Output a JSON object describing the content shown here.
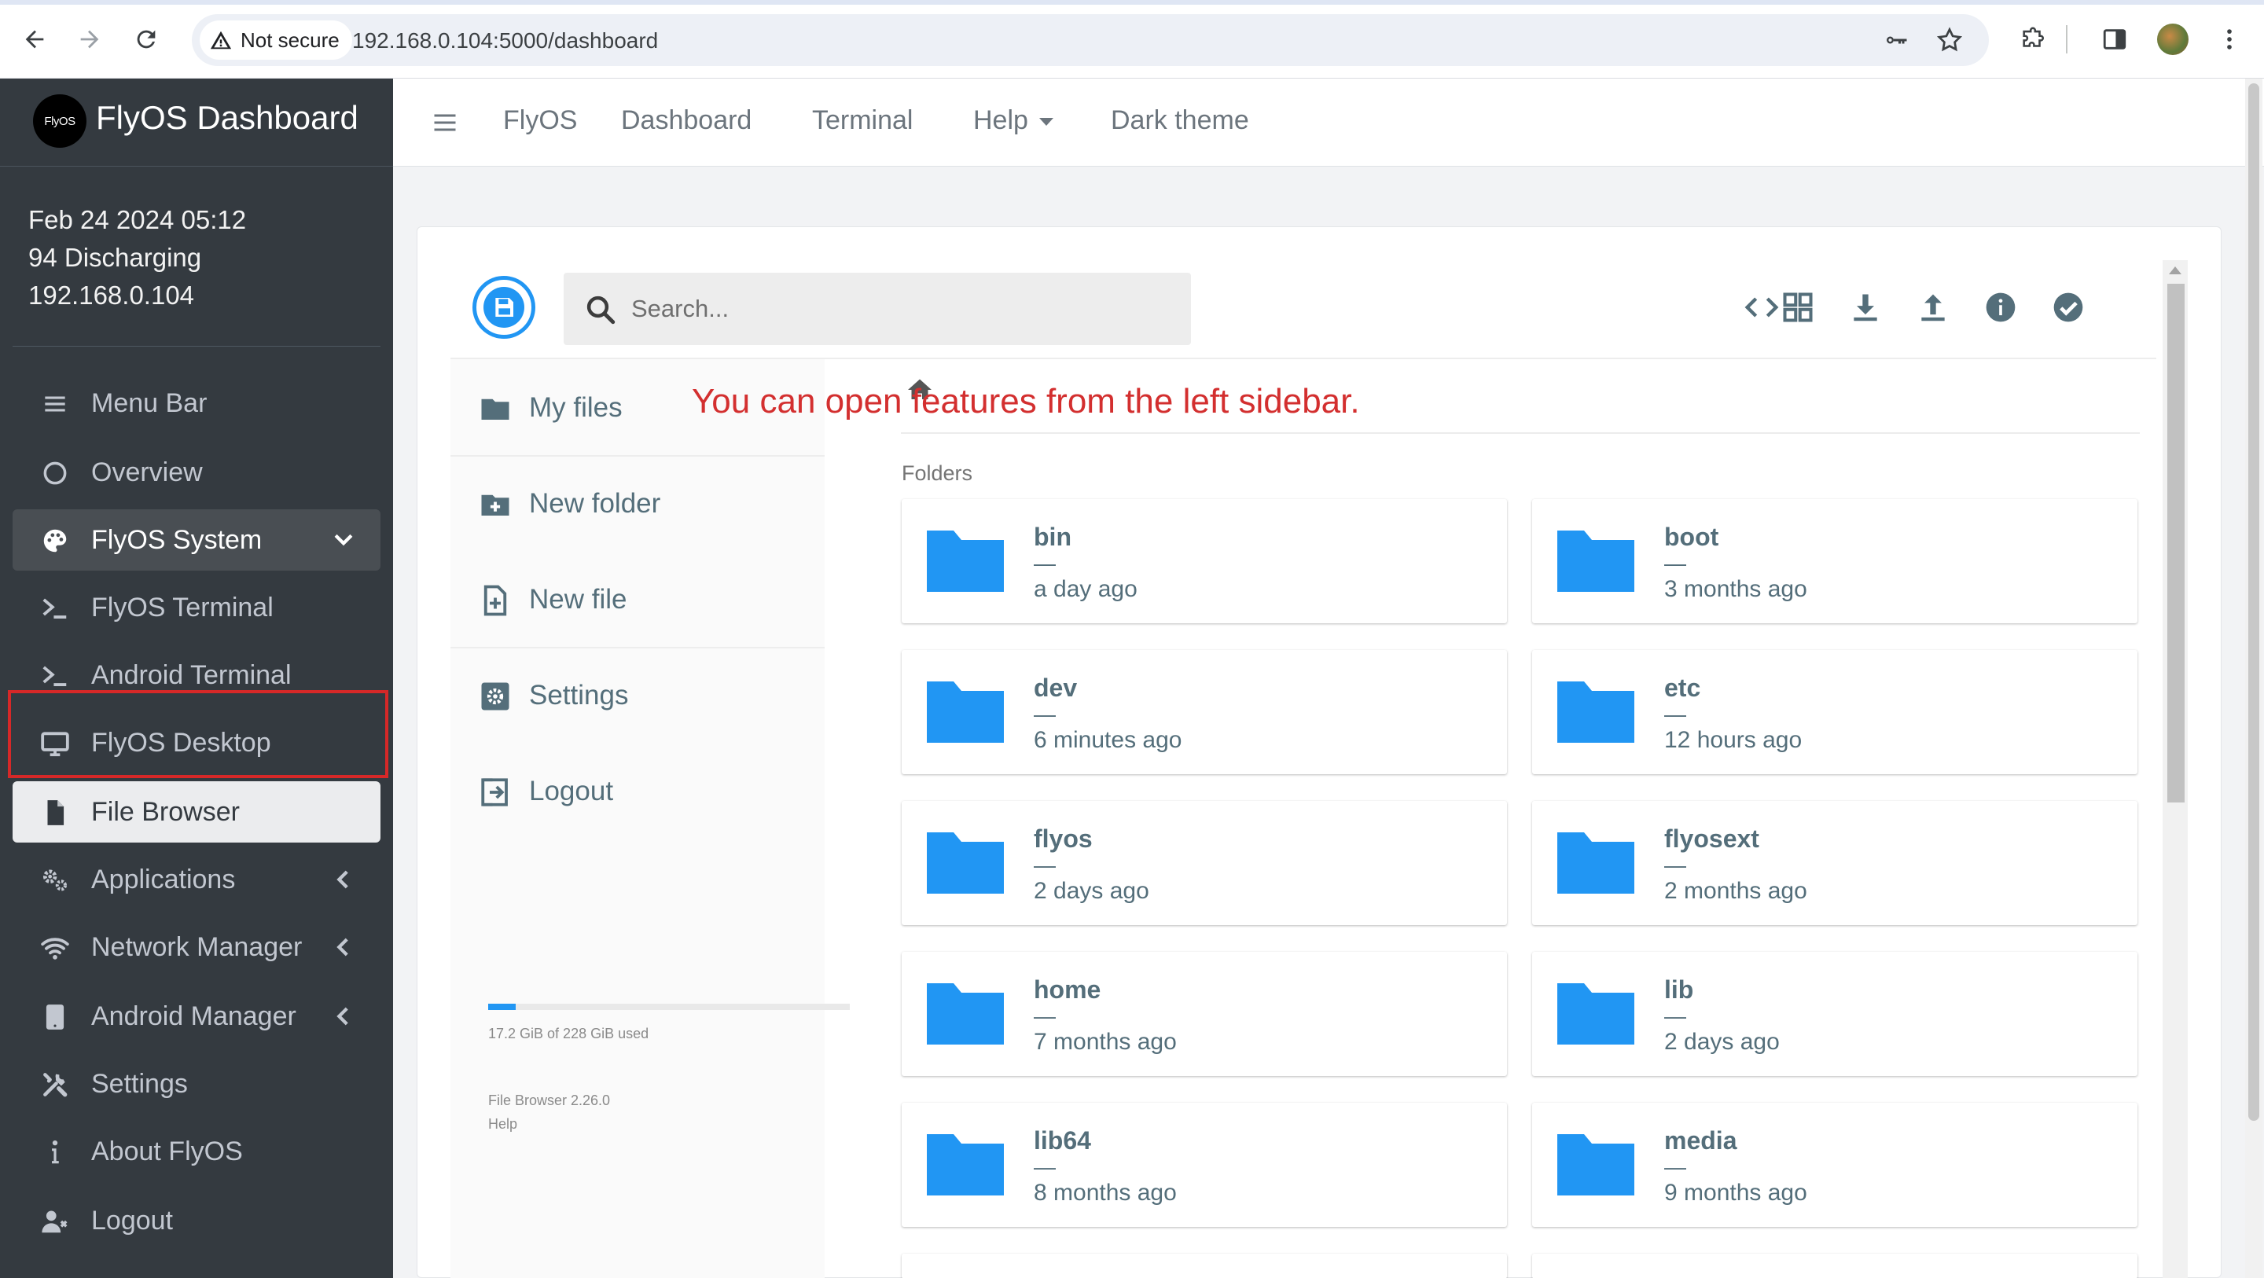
{
  "browser": {
    "security_label": "Not secure",
    "url": "192.168.0.104:5000/dashboard"
  },
  "sidebar": {
    "brand_logo_text": "FlyOS",
    "brand_title": "FlyOS Dashboard",
    "info": {
      "datetime": "Feb 24 2024 05:12",
      "battery": "94 Discharging",
      "ip": "192.168.0.104"
    },
    "items": [
      {
        "label": "Menu Bar",
        "icon": "menu-icon"
      },
      {
        "label": "Overview",
        "icon": "circle-icon"
      },
      {
        "label": "FlyOS System",
        "icon": "palette-icon",
        "state": "open"
      },
      {
        "label": "FlyOS Terminal",
        "icon": "terminal-icon"
      },
      {
        "label": "Android Terminal",
        "icon": "terminal-icon"
      },
      {
        "label": "FlyOS Desktop",
        "icon": "desktop-icon"
      },
      {
        "label": "File Browser",
        "icon": "file-icon",
        "state": "active"
      },
      {
        "label": "Applications",
        "icon": "gears-icon"
      },
      {
        "label": "Network Manager",
        "icon": "wifi-icon"
      },
      {
        "label": "Android Manager",
        "icon": "tablet-icon"
      },
      {
        "label": "Settings",
        "icon": "tools-icon"
      },
      {
        "label": "About FlyOS",
        "icon": "info-icon"
      },
      {
        "label": "Logout",
        "icon": "user-icon"
      }
    ]
  },
  "topnav": {
    "links": [
      "FlyOS",
      "Dashboard",
      "Terminal",
      "Help",
      "Dark theme"
    ]
  },
  "filebrowser": {
    "search_placeholder": "Search...",
    "side_items": [
      "My files",
      "New folder",
      "New file",
      "Settings",
      "Logout"
    ],
    "usage": {
      "text": "17.2 GiB of 228 GiB used",
      "fraction": 0.075
    },
    "version": "File Browser 2.26.0",
    "help": "Help",
    "folders_label": "Folders",
    "folders": [
      {
        "name": "bin",
        "size": "—",
        "modified": "a day ago"
      },
      {
        "name": "boot",
        "size": "—",
        "modified": "3 months ago"
      },
      {
        "name": "dev",
        "size": "—",
        "modified": "6 minutes ago"
      },
      {
        "name": "etc",
        "size": "—",
        "modified": "12 hours ago"
      },
      {
        "name": "flyos",
        "size": "—",
        "modified": "2 days ago"
      },
      {
        "name": "flyosext",
        "size": "—",
        "modified": "2 months ago"
      },
      {
        "name": "home",
        "size": "—",
        "modified": "7 months ago"
      },
      {
        "name": "lib",
        "size": "—",
        "modified": "2 days ago"
      },
      {
        "name": "lib64",
        "size": "—",
        "modified": "8 months ago"
      },
      {
        "name": "media",
        "size": "—",
        "modified": "9 months ago"
      }
    ]
  },
  "annotation": {
    "text": "You can open features from the left sidebar.",
    "color": "#d32f2f"
  },
  "colors": {
    "sidebar_bg": "#343a40",
    "accent": "#2196f3",
    "highlight": "#d62828"
  }
}
